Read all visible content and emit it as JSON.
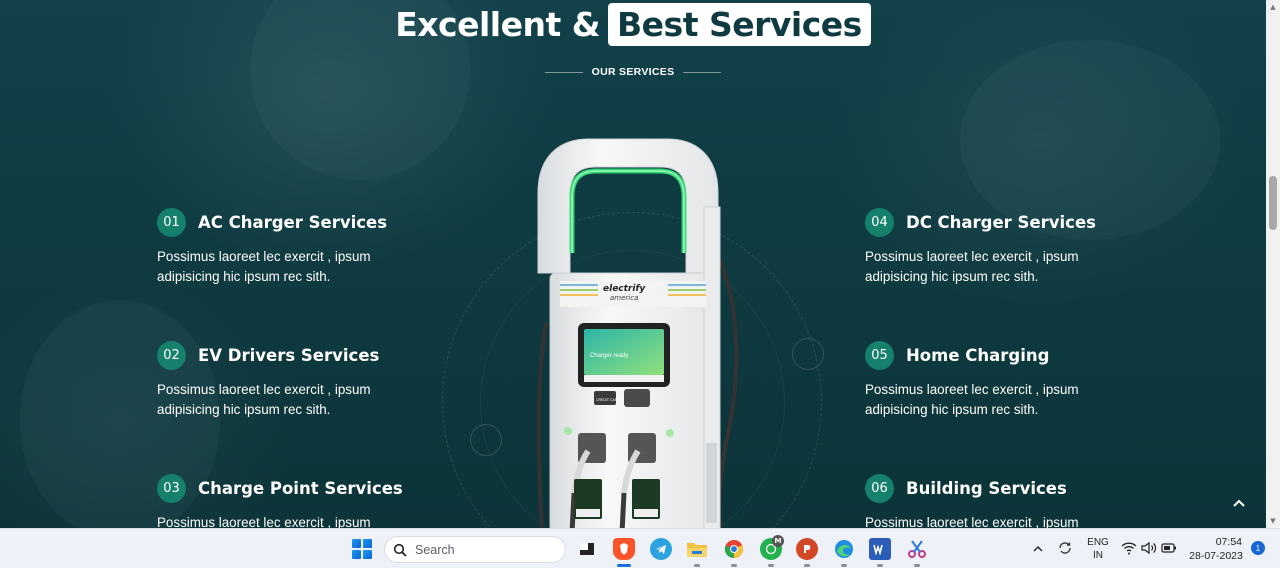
{
  "heading": {
    "plain": "Excellent &",
    "highlight": "Best Services"
  },
  "subtitle": "OUR SERVICES",
  "services": [
    {
      "num": "01",
      "title": "AC Charger Services",
      "desc": "Possimus laoreet lec exercit , ipsum adipisicing hic ipsum rec sith."
    },
    {
      "num": "02",
      "title": "EV Drivers Services",
      "desc": "Possimus laoreet lec exercit , ipsum adipisicing hic ipsum rec sith."
    },
    {
      "num": "03",
      "title": "Charge Point Services",
      "desc": "Possimus laoreet lec exercit , ipsum"
    },
    {
      "num": "04",
      "title": "DC Charger Services",
      "desc": "Possimus laoreet lec exercit , ipsum adipisicing hic ipsum rec sith."
    },
    {
      "num": "05",
      "title": "Home Charging",
      "desc": "Possimus laoreet lec exercit , ipsum adipisicing hic ipsum rec sith."
    },
    {
      "num": "06",
      "title": "Building Services",
      "desc": "Possimus laoreet lec exercit , ipsum"
    }
  ],
  "charger": {
    "brand_line1": "electrify",
    "brand_line2": "america",
    "screen_text": "Charger ready",
    "card_label": "CREDIT CARD"
  },
  "icons": {
    "scroll_top": "chevron-up-icon",
    "start": "windows-start-icon",
    "search": "search-icon"
  },
  "taskbar": {
    "search_placeholder": "Search",
    "apps": [
      "file-explorer-icon",
      "brave-browser-icon",
      "telegram-icon",
      "folder-icon",
      "chrome-icon",
      "whatsapp-icon",
      "powerpoint-icon",
      "edge-icon",
      "word-icon",
      "snipping-tool-icon"
    ],
    "whatsapp_badge": "M",
    "lang": "ENG",
    "region": "IN",
    "time": "07:54",
    "date": "28-07-2023",
    "notifications": "1"
  },
  "colors": {
    "bg": "#0f3b40",
    "accent": "#15806b",
    "charger_glow": "#38e07a"
  }
}
